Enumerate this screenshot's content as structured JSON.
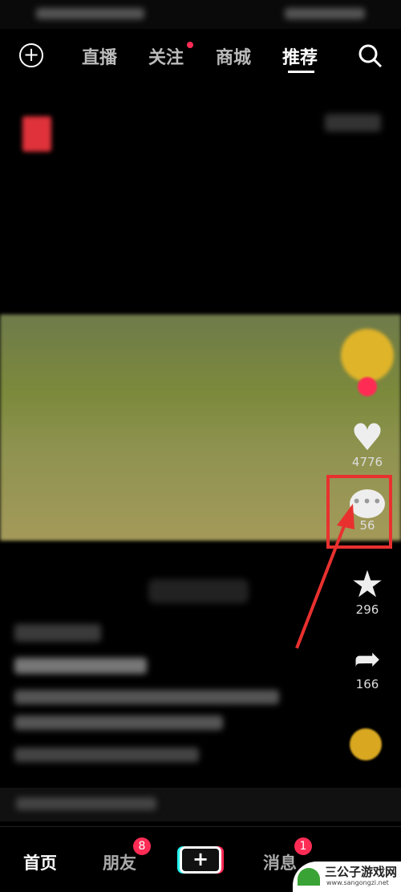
{
  "top_nav": {
    "tabs": [
      {
        "label": "直播"
      },
      {
        "label": "关注",
        "has_dot": true
      },
      {
        "label": "商城"
      },
      {
        "label": "推荐",
        "active": true
      }
    ],
    "icons": [
      "plus-circle-icon",
      "search-icon"
    ]
  },
  "actions": {
    "likes": "4776",
    "comments": "56",
    "favorites": "296",
    "shares": "166"
  },
  "bottom_nav": {
    "tabs": [
      {
        "label": "首页",
        "active": true
      },
      {
        "label": "朋友",
        "badge": "8"
      },
      {
        "label": "+"
      },
      {
        "label": "消息",
        "badge": "1"
      }
    ]
  },
  "watermark": {
    "name": "三公子游戏网",
    "url": "www.sangongzi.net"
  },
  "colors": {
    "accent": "#fe2c55",
    "annotation": "#e8312f"
  }
}
